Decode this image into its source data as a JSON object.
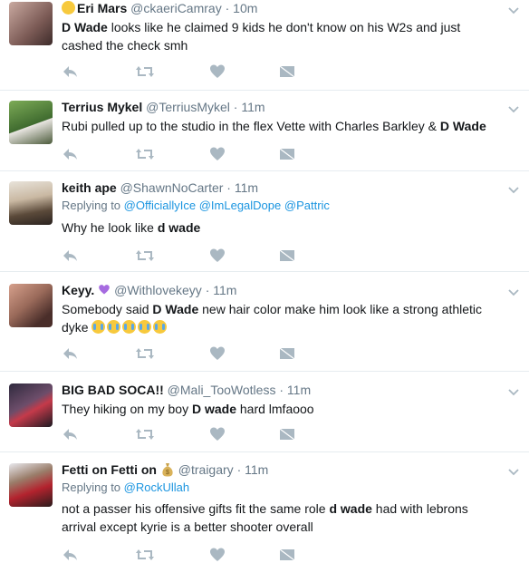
{
  "tweets": [
    {
      "name": "Eri Mars",
      "handle": "@ckaeriCamray",
      "time": "10m",
      "text_parts": [
        "D Wade",
        " looks like he claimed 9 kids he don't know on his W2s and just cashed the check smh"
      ]
    },
    {
      "name": "Terrius Mykel",
      "handle": "@TerriusMykel",
      "time": "11m",
      "text_parts": [
        "Rubi pulled up to the studio in the flex Vette with Charles Barkley & ",
        "D Wade"
      ]
    },
    {
      "name": "keith ape",
      "handle": "@ShawnNoCarter",
      "time": "11m",
      "replying_label": "Replying to",
      "replying_to": [
        "@OfficiallyIce",
        "@ImLegalDope",
        "@Pattric"
      ],
      "text_parts": [
        "Why he look like ",
        "d wade"
      ]
    },
    {
      "name": "Keyy.",
      "handle": "@Withlovekeyy",
      "time": "11m",
      "text_parts": [
        "Somebody said ",
        "D Wade",
        " new hair color make him look like a strong athletic dyke"
      ]
    },
    {
      "name": "BIG BAD SOCA!!",
      "handle": "@Mali_TooWotless",
      "time": "11m",
      "text_parts": [
        "They hiking on my boy ",
        "D wade",
        " hard lmfaooo"
      ]
    },
    {
      "name": "Fetti on Fetti on",
      "handle": "@traigary",
      "time": "11m",
      "replying_label": "Replying to",
      "replying_to": [
        "@RockUllah"
      ],
      "text_parts": [
        "not a passer his offensive gifts fit the same role ",
        "d wade",
        " had with lebrons arrival except kyrie is a better shooter overall"
      ]
    }
  ],
  "dot_separator": "·",
  "icons": {
    "reply": "reply-icon",
    "retweet": "retweet-icon",
    "like": "heart-icon",
    "message": "envelope-icon",
    "more": "chevron-down-icon"
  },
  "colors": {
    "action_gray": "#aab8c2",
    "meta_gray": "#657786",
    "link_blue": "#1b95e0",
    "divider": "#e6ecf0"
  }
}
